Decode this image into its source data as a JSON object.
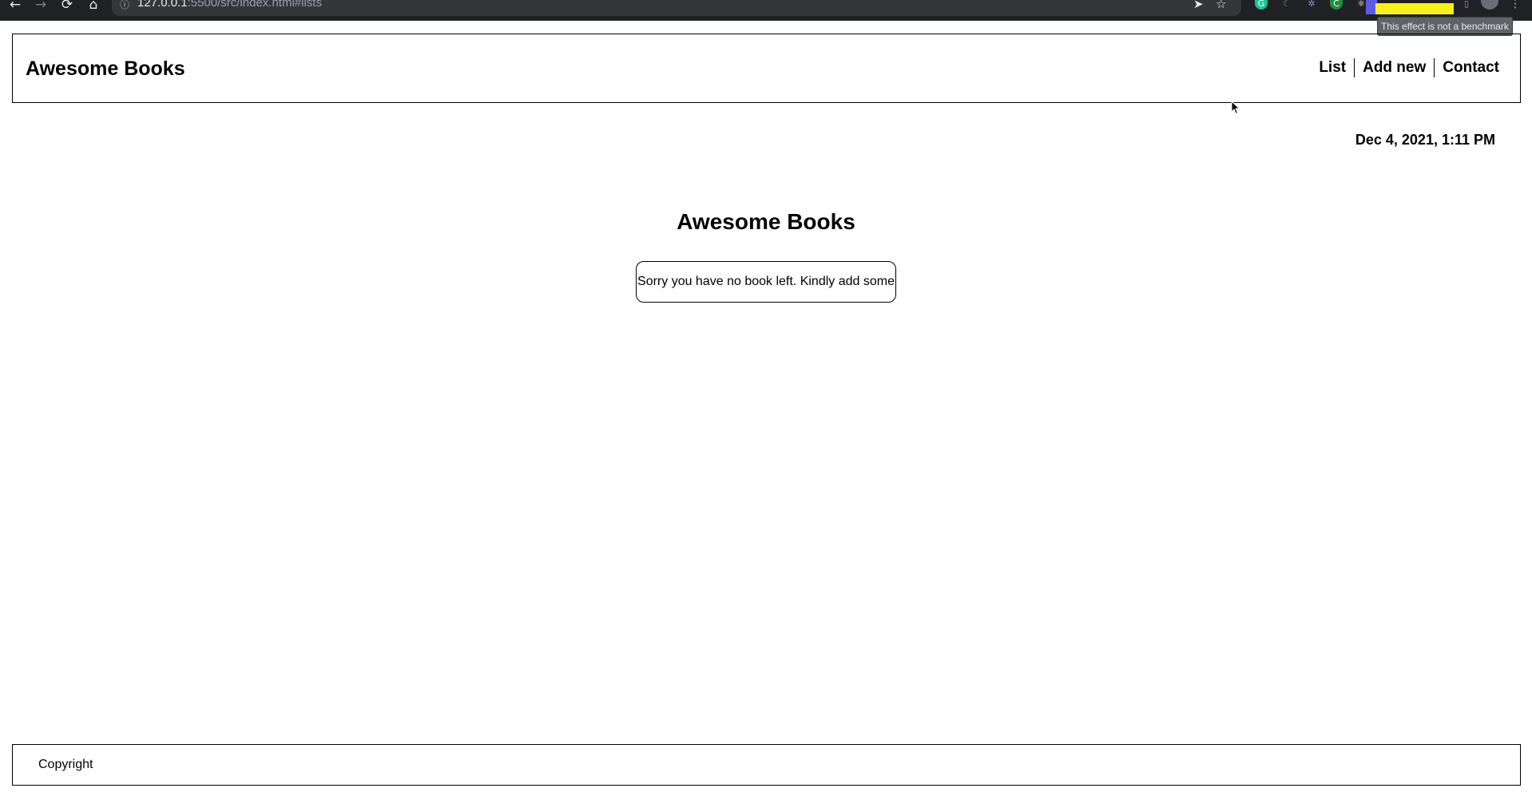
{
  "browser": {
    "url_host": "127.0.0.1",
    "url_path": ":5500/src/index.html#lists",
    "tooltip": "This effect is not a benchmark",
    "icons": {
      "back": "arrow-left-icon",
      "forward": "arrow-right-icon",
      "reload": "reload-icon",
      "home": "home-icon",
      "info": "info-icon",
      "send": "send-icon",
      "star": "star-icon"
    },
    "colors": {
      "chrome": "#202124",
      "omnibox": "#35363a",
      "highlight": "#f7f31a"
    }
  },
  "header": {
    "brand": "Awesome Books",
    "nav": [
      {
        "label": "List"
      },
      {
        "label": "Add new"
      },
      {
        "label": "Contact"
      }
    ]
  },
  "main": {
    "date": "Dec 4, 2021, 1:11 PM",
    "title": "Awesome Books",
    "empty_message": "Sorry you have no book left. Kindly add some"
  },
  "footer": {
    "copyright": "Copyright"
  }
}
